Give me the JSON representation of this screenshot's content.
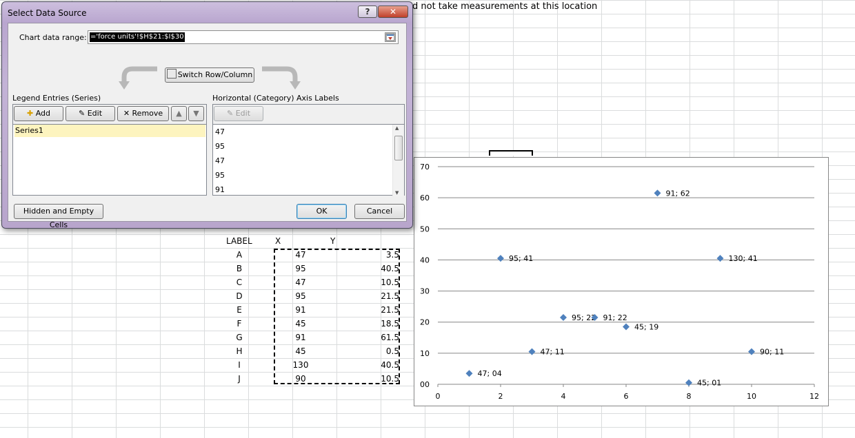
{
  "sheet": {
    "top_text": "d not take measurements at this location",
    "table": {
      "headers": [
        "LABEL",
        "X",
        "Y"
      ],
      "rows": [
        {
          "label": "A",
          "x": "47",
          "y": "3.5"
        },
        {
          "label": "B",
          "x": "95",
          "y": "40.5"
        },
        {
          "label": "C",
          "x": "47",
          "y": "10.5"
        },
        {
          "label": "D",
          "x": "95",
          "y": "21.5"
        },
        {
          "label": "E",
          "x": "91",
          "y": "21.5"
        },
        {
          "label": "F",
          "x": "45",
          "y": "18.5"
        },
        {
          "label": "G",
          "x": "91",
          "y": "61.5"
        },
        {
          "label": "H",
          "x": "45",
          "y": "0.5"
        },
        {
          "label": "I",
          "x": "130",
          "y": "40.5"
        },
        {
          "label": "J",
          "x": "90",
          "y": "10.5"
        }
      ]
    }
  },
  "chart_data": {
    "type": "scatter",
    "title": "",
    "xlabel": "",
    "ylabel": "",
    "xlim": [
      0,
      12
    ],
    "ylim": [
      0,
      70
    ],
    "x_ticks": [
      "0",
      "2",
      "4",
      "6",
      "8",
      "10",
      "12"
    ],
    "y_ticks": [
      "00",
      "10",
      "20",
      "30",
      "40",
      "50",
      "60",
      "70"
    ],
    "grid": "horizontal",
    "marker_color": "#4f81bd",
    "points": [
      {
        "x": 1,
        "y": 3.5,
        "label": "47; 04"
      },
      {
        "x": 2,
        "y": 40.5,
        "label": "95; 41"
      },
      {
        "x": 3,
        "y": 10.5,
        "label": "47; 11"
      },
      {
        "x": 4,
        "y": 21.5,
        "label": "95; 22"
      },
      {
        "x": 5,
        "y": 21.5,
        "label": "91; 22"
      },
      {
        "x": 6,
        "y": 18.5,
        "label": "45; 19"
      },
      {
        "x": 7,
        "y": 61.5,
        "label": "91; 62"
      },
      {
        "x": 8,
        "y": 0.5,
        "label": "45; 01"
      },
      {
        "x": 9,
        "y": 40.5,
        "label": "130; 41"
      },
      {
        "x": 10,
        "y": 10.5,
        "label": "90; 11"
      }
    ]
  },
  "dialog": {
    "title": "Select Data Source",
    "help_label": "?",
    "close_label": "✕",
    "chart_range_label": "Chart data range:",
    "chart_range_value": "='force units'!$H$21:$I$30",
    "switch_label": "Switch Row/Column",
    "legend_header": "Legend Entries (Series)",
    "axis_header": "Horizontal (Category) Axis Labels",
    "add_label": "Add",
    "edit_label": "Edit",
    "remove_label": "Remove",
    "axis_edit_label": "Edit",
    "series": [
      "Series1"
    ],
    "axis_labels": [
      "47",
      "95",
      "47",
      "95",
      "91"
    ],
    "hidden_cells_label": "Hidden and Empty Cells",
    "ok_label": "OK",
    "cancel_label": "Cancel"
  }
}
